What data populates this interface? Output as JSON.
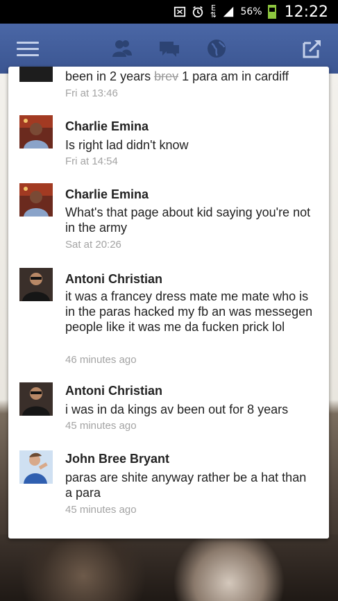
{
  "status_bar": {
    "network_type": "E",
    "battery_percent": "56%",
    "time": "12:22",
    "icons": [
      "nfc-icon",
      "alarm-icon",
      "data-arrows-icon",
      "signal-icon",
      "battery-icon"
    ]
  },
  "fb_bar": {
    "icons": [
      "menu-icon",
      "friend-requests-icon",
      "messages-icon",
      "notifications-globe-icon",
      "compose-icon"
    ],
    "brand_color": "#3b5998"
  },
  "messages": [
    {
      "name": "",
      "text_before": "been in 2 years ",
      "text_strike": "brev",
      "text_after": " 1 para am in cardiff",
      "time": "Fri at 13:46"
    },
    {
      "name": "Charlie Emina",
      "text": "Is right lad didn't know",
      "time": "Fri at 14:54"
    },
    {
      "name": "Charlie Emina",
      "text": "What's that page about kid saying you're not in the army",
      "time": "Sat at 20:26"
    },
    {
      "name": "Antoni Christian",
      "text": "it was a francey dress mate me mate who is in the paras  hacked my fb an was messegen people like it was me  da fucken prick lol",
      "time": "46 minutes ago"
    },
    {
      "name": "Antoni Christian",
      "text": "i was in da kings  av been out for 8 years",
      "time": "45 minutes ago"
    },
    {
      "name": "John Bree Bryant",
      "text": "paras are shite anyway rather be a hat than a para",
      "time": "45 minutes ago"
    }
  ]
}
